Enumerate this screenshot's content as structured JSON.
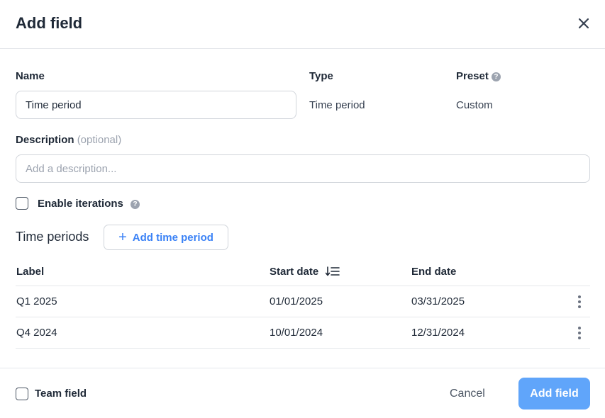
{
  "dialog": {
    "title": "Add field",
    "close_icon": "close-icon"
  },
  "form": {
    "name_label": "Name",
    "name_value": "Time period",
    "type_label": "Type",
    "type_value": "Time period",
    "preset_label": "Preset",
    "preset_value": "Custom",
    "description_label": "Description",
    "description_optional": "(optional)",
    "description_placeholder": "Add a description...",
    "enable_iterations_label": "Enable iterations"
  },
  "time_periods": {
    "title": "Time periods",
    "add_button_label": "Add time period",
    "columns": {
      "label": "Label",
      "start_date": "Start date",
      "end_date": "End date"
    },
    "rows": [
      {
        "label": "Q1 2025",
        "start_date": "01/01/2025",
        "end_date": "03/31/2025"
      },
      {
        "label": "Q4 2024",
        "start_date": "10/01/2024",
        "end_date": "12/31/2024"
      }
    ]
  },
  "footer": {
    "team_field_label": "Team field",
    "cancel_label": "Cancel",
    "submit_label": "Add field"
  },
  "colors": {
    "accent": "#3b82f6",
    "submit_bg": "#60a5fa"
  }
}
